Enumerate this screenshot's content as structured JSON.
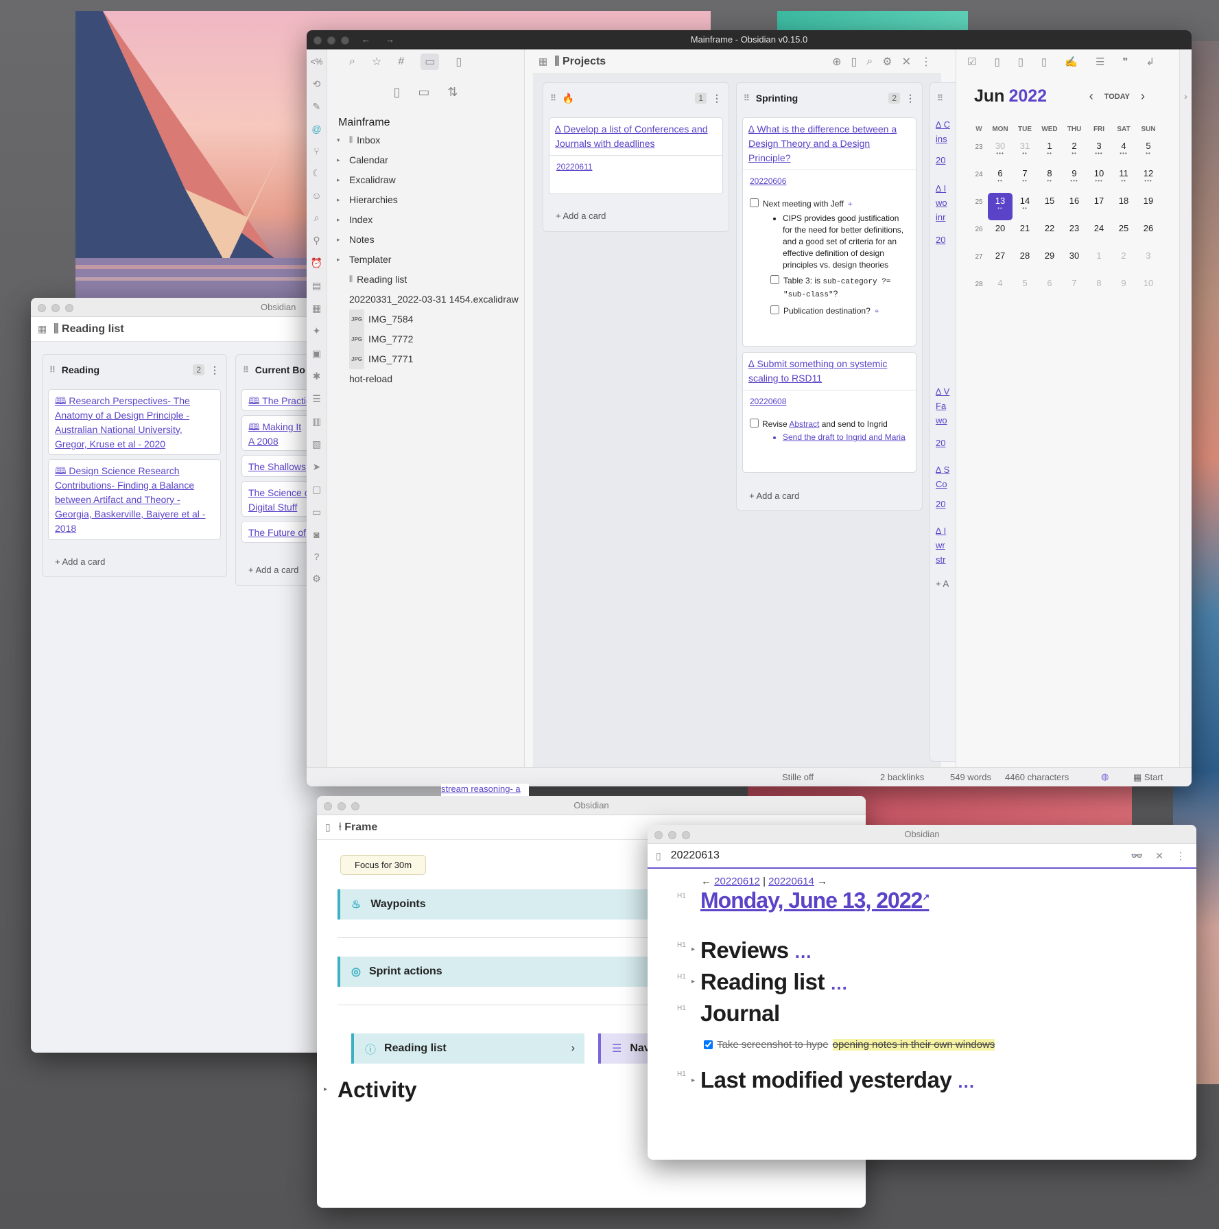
{
  "main_window": {
    "title": "Mainframe - Obsidian v0.15.0",
    "nav_back": "←",
    "nav_forward": "→",
    "left_ribbon_top": "<%",
    "file_tree": {
      "vault": "Mainframe",
      "items": [
        {
          "label": "Inbox",
          "icon": "kanban-icon",
          "type": "folder-open"
        },
        {
          "label": "Calendar",
          "type": "folder"
        },
        {
          "label": "Excalidraw",
          "type": "folder"
        },
        {
          "label": "Hierarchies",
          "type": "folder"
        },
        {
          "label": "Index",
          "type": "folder"
        },
        {
          "label": "Notes",
          "type": "folder"
        },
        {
          "label": "Templater",
          "type": "folder"
        },
        {
          "label": "Reading list",
          "icon": "kanban-icon",
          "type": "file"
        },
        {
          "label": "20220331_2022-03-31 1454.excalidraw",
          "type": "file"
        },
        {
          "label": "IMG_7584",
          "badge": "JPG",
          "type": "file"
        },
        {
          "label": "IMG_7772",
          "badge": "JPG",
          "type": "file"
        },
        {
          "label": "IMG_7771",
          "badge": "JPG",
          "type": "file"
        },
        {
          "label": "hot-reload",
          "type": "file"
        }
      ]
    },
    "pane_title": "Projects",
    "kanban": {
      "columns": [
        {
          "title": "🔥",
          "count": "1",
          "cards": [
            {
              "title": "Develop a list of Conferences and Journals with deadlines",
              "date": "20220611"
            }
          ],
          "add": "+ Add a card"
        },
        {
          "title": "Sprinting",
          "count": "2",
          "cards": [
            {
              "title": "What is the difference between a Design Theory and a Design Principle?",
              "date": "20220606",
              "task1": "Next meeting with Jeff",
              "bullet": "CIPS provides good justification for the need for better definitions, and a good set of criteria for an effective definition of design principles vs. design theories",
              "task2_prefix": "Table 3: is",
              "task2_code": "sub-category ?= \"sub-class\"",
              "task2_suffix": "?",
              "task3": "Publication destination?"
            },
            {
              "title": "Submit something on systemic scaling to RSD11",
              "date": "20220608",
              "task_prefix": "Revise",
              "task_link": "Abstract",
              "task_suffix": "and send to Ingrid",
              "sub_link": "Send the draft to Ingrid and Maria"
            }
          ],
          "add": "+ Add a card"
        }
      ],
      "peek_fragments": [
        "∆ C",
        "ins",
        "20",
        "∆ I",
        "wo",
        "inr",
        "20",
        "∆ V",
        "Fa",
        "wo",
        "20",
        "∆ S",
        "Co",
        "20",
        "∆ I",
        "wr",
        "str",
        "+ A"
      ]
    },
    "calendar": {
      "month": "Jun",
      "year": "2022",
      "today_label": "TODAY",
      "headers": [
        "W",
        "MON",
        "TUE",
        "WED",
        "THU",
        "FRI",
        "SAT",
        "SUN"
      ],
      "rows": [
        {
          "wk": "23",
          "days": [
            "30",
            "31",
            "1",
            "2",
            "3",
            "4",
            "5"
          ]
        },
        {
          "wk": "24",
          "days": [
            "6",
            "7",
            "8",
            "9",
            "10",
            "11",
            "12"
          ]
        },
        {
          "wk": "25",
          "days": [
            "13",
            "14",
            "15",
            "16",
            "17",
            "18",
            "19"
          ]
        },
        {
          "wk": "26",
          "days": [
            "20",
            "21",
            "22",
            "23",
            "24",
            "25",
            "26"
          ]
        },
        {
          "wk": "27",
          "days": [
            "27",
            "28",
            "29",
            "30",
            "1",
            "2",
            "3"
          ]
        },
        {
          "wk": "28",
          "days": [
            "4",
            "5",
            "6",
            "7",
            "8",
            "9",
            "10"
          ]
        }
      ],
      "today": "13",
      "accent": "#5b43c8"
    },
    "status_bar": {
      "stille": "Stille off",
      "backlinks": "2 backlinks",
      "words": "549 words",
      "chars": "4460 characters",
      "start": "Start"
    }
  },
  "reading_window": {
    "title": "Obsidian",
    "pane_title": "Reading list",
    "columns": [
      {
        "title": "Reading",
        "count": "2",
        "cards": [
          "🕮 Research Perspectives- The Anatomy of a Design Principle - Australian National University, Gregor, Kruse et al - 2020",
          "🕮 Design Science Research Contributions- Finding a Balance between Artifact and Theory - Georgia, Baskerville, Baiyere et al - 2018"
        ],
        "add": "+ Add a card"
      },
      {
        "title": "Current Bo",
        "cards": [
          "🕮 The Practic",
          "🕮 Making It A 2008",
          "The Shallows",
          "The Science c Digital Stuff",
          "The Future of"
        ],
        "add": "+ Add a card"
      }
    ]
  },
  "frame_window": {
    "title": "Obsidian",
    "pane_title": "Frame",
    "peek_link": "stream reasoning- a",
    "focus_button": "Focus for 30m",
    "sections": [
      "Waypoints",
      "Sprint actions"
    ],
    "reading_list": "Reading list",
    "navi": "Navi",
    "activity": "Activity"
  },
  "daily_window": {
    "title": "Obsidian",
    "pane_title": "20220613",
    "prev": "20220612",
    "next": "20220614",
    "h1_tag": "H1",
    "date_heading": "Monday, June 13, 2022",
    "headings": [
      "Reviews",
      "Reading list",
      "Journal",
      "Last modified yesterday"
    ],
    "task_struck": "Take screenshot to hype",
    "task_highlight": "opening notes in their own windows"
  }
}
